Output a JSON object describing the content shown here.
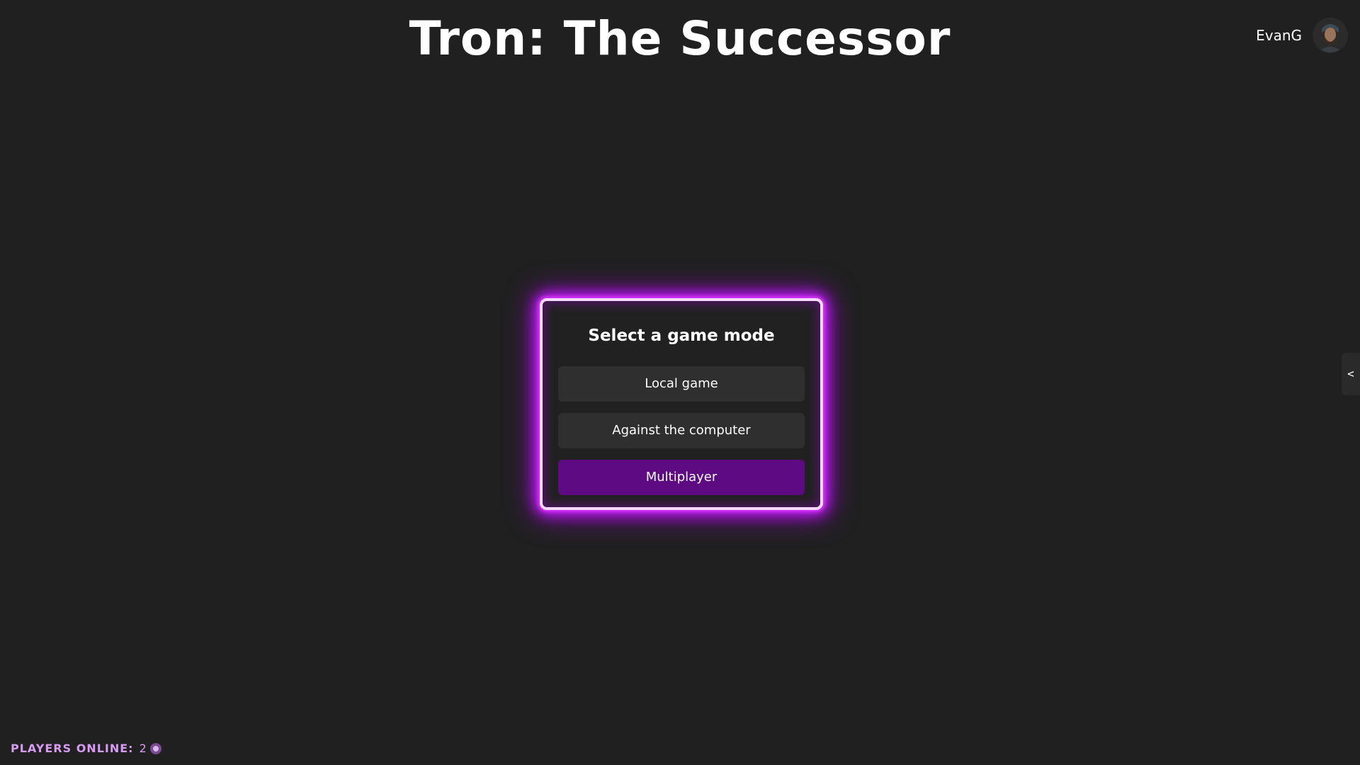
{
  "header": {
    "title": "Tron: The Successor"
  },
  "user": {
    "name": "EvanG",
    "avatar_icon": "user-avatar-icon"
  },
  "modal": {
    "title": "Select a game mode",
    "modes": [
      {
        "label": "Local game",
        "selected": false
      },
      {
        "label": "Against the computer",
        "selected": false
      },
      {
        "label": "Multiplayer",
        "selected": true
      }
    ]
  },
  "side_panel": {
    "toggle_label": "<"
  },
  "footer": {
    "players_online_label": "PLAYERS ONLINE:",
    "players_online_count": "2"
  },
  "colors": {
    "background": "#202020",
    "neon_border": "#c41eff",
    "selected_button": "#5e0a82",
    "button": "#2f2f2f",
    "players_online_text": "#d79bf2"
  }
}
